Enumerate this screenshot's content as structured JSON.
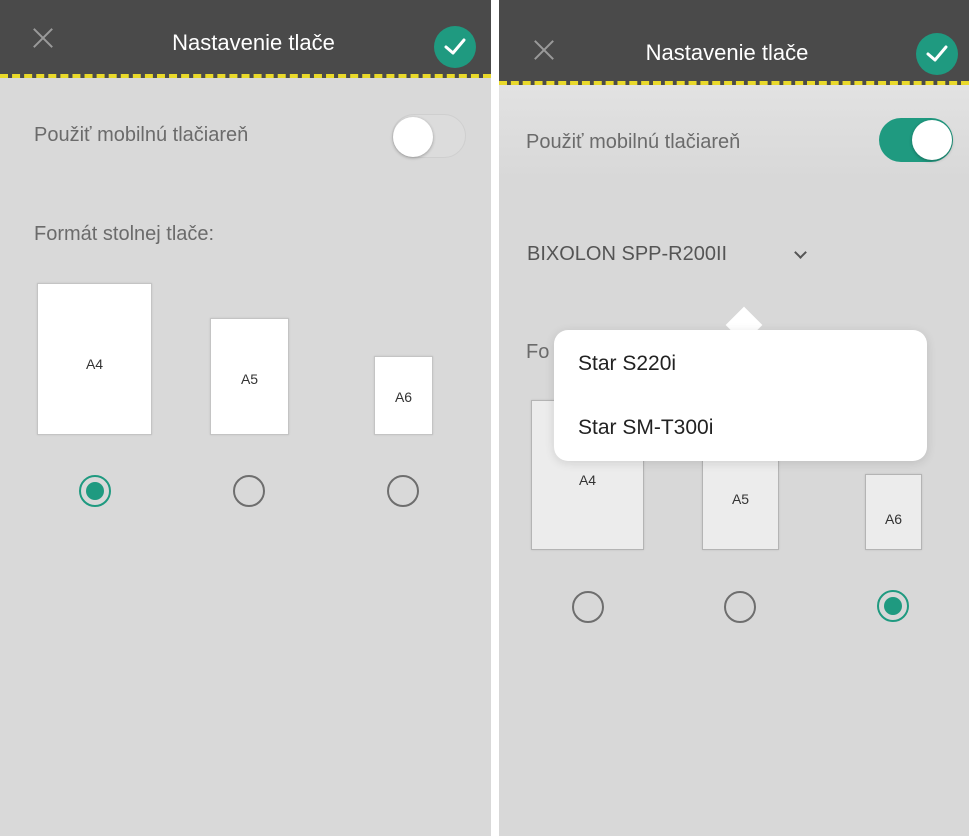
{
  "screens": [
    {
      "header": {
        "title": "Nastavenie tlače",
        "close_icon": "close-icon",
        "confirm_icon": "check-icon",
        "accent": "#1f9a80"
      },
      "mobile_printer": {
        "label": "Použiť mobilnú tlačiareň",
        "enabled": false
      },
      "desktop_format": {
        "label": "Formát stolnej tlače:"
      },
      "formats": [
        {
          "label": "A4",
          "selected": true
        },
        {
          "label": "A5",
          "selected": false
        },
        {
          "label": "A6",
          "selected": false
        }
      ]
    },
    {
      "header": {
        "title": "Nastavenie tlače",
        "close_icon": "close-icon",
        "confirm_icon": "check-icon",
        "accent": "#1f9a80"
      },
      "mobile_printer": {
        "label": "Použiť mobilnú tlačiareň",
        "enabled": true
      },
      "printer": {
        "selected": "BIXOLON SPP-R200II",
        "icon": "chevron-down-icon"
      },
      "desktop_format": {
        "label_visible_fragment": "Fo"
      },
      "printer_options": [
        "Star S220i",
        "Star SM-T300i"
      ],
      "formats": [
        {
          "label": "A4",
          "selected": false
        },
        {
          "label": "A5",
          "selected": false
        },
        {
          "label": "A6",
          "selected": true
        }
      ]
    }
  ]
}
